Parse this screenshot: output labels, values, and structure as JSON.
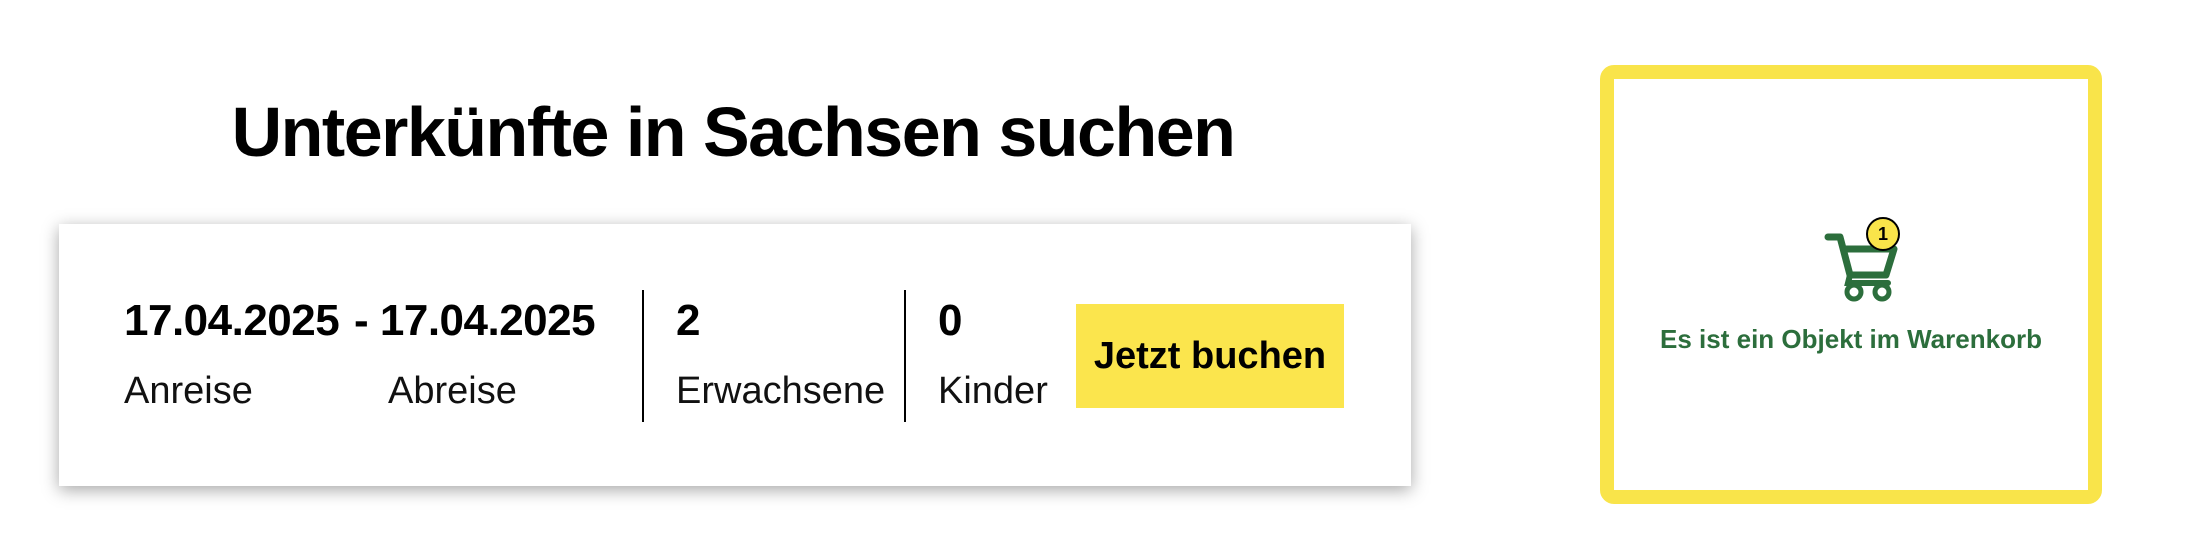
{
  "heading": "Unterkünfte in Sachsen suchen",
  "search": {
    "arrival_value": "17.04.2025",
    "arrival_label": "Anreise",
    "departure_value": "- 17.04.2025",
    "departure_label": "Abreise",
    "adults_value": "2",
    "adults_label": "Erwachsene",
    "children_value": "0",
    "children_label": "Kinder",
    "book_button": "Jetzt buchen"
  },
  "cart": {
    "icon": "shopping-cart-icon",
    "badge_count": "1",
    "message": "Es ist ein Objekt im Warenkorb"
  },
  "colors": {
    "accent_yellow": "#f9e44a",
    "cart_green": "#2c6e3c"
  }
}
